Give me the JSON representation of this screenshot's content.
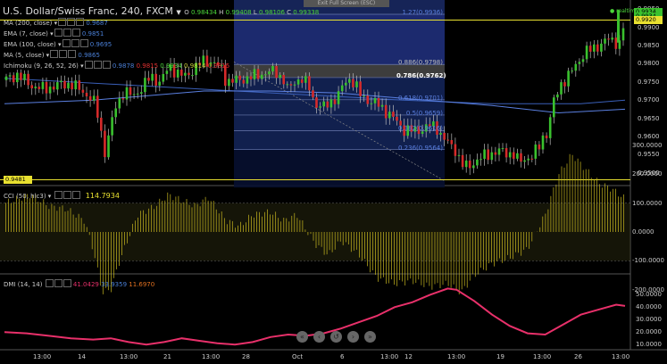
{
  "header": {
    "symbol": "U.S. Dollar/Swiss Franc, 240, FXCM",
    "ohlc": [
      {
        "k": "O",
        "v": "0.98434"
      },
      {
        "k": "H",
        "v": "0.99408"
      },
      {
        "k": "L",
        "v": "0.98106"
      },
      {
        "k": "C",
        "v": "0.99338"
      }
    ],
    "exit_fullscreen": "Exit Full Screen (ESC)",
    "realtime": "realtime"
  },
  "indicators": [
    {
      "label": "MA (200, close)",
      "values": [
        {
          "v": "0.9687",
          "color": "#4a7fd6"
        }
      ]
    },
    {
      "label": "EMA (7, close)",
      "values": [
        {
          "v": "0.9851",
          "color": "#4a7fd6"
        }
      ]
    },
    {
      "label": "EMA (100, close)",
      "values": [
        {
          "v": "0.9695",
          "color": "#4a7fd6"
        }
      ]
    },
    {
      "label": "MA (5, close)",
      "values": [
        {
          "v": "0.9865",
          "color": "#4a7fd6"
        }
      ]
    },
    {
      "label": "Ichimoku (9, 26, 52, 26)",
      "values": [
        {
          "v": "0.9878",
          "color": "#4a7fd6"
        },
        {
          "v": "0.9815",
          "color": "#e03030"
        },
        {
          "v": "0.9934",
          "color": "#4cd63a"
        },
        {
          "v": "0.9814",
          "color": "#cbd23a"
        },
        {
          "v": "0.9815",
          "color": "#e03030"
        }
      ]
    }
  ],
  "fib_levels": [
    {
      "label": "1.27(0.9936)",
      "value": 0.9936
    },
    {
      "label": "0.886(0.9798)",
      "value": 0.9798
    },
    {
      "label": "0.786(0.9762)",
      "value": 0.9762
    },
    {
      "label": "0.618(0.9701)",
      "value": 0.9701
    },
    {
      "label": "0.5(0.9659)",
      "value": 0.9659
    },
    {
      "label": "0.382(0.9616)",
      "value": 0.9616
    },
    {
      "label": "0.236(0.9564)",
      "value": 0.9564
    }
  ],
  "price_axis": {
    "ticks": [
      "0.9950",
      "0.9900",
      "0.9850",
      "0.9800",
      "0.9750",
      "0.9700",
      "0.9650",
      "0.9600",
      "0.9550",
      "0.9500"
    ],
    "current_price_labels": [
      "0.9934",
      "0.9934"
    ],
    "level_labels": [
      "0.9920",
      "0.9481"
    ]
  },
  "cci_panel": {
    "label": "CCI (50, hlc3)",
    "value": "114.7934",
    "ticks": [
      "300.0000",
      "200.0000",
      "100.0000",
      "0.0000",
      "-100.0000",
      "-200.0000"
    ]
  },
  "dmi_panel": {
    "label": "DMI (14, 14)",
    "values": [
      {
        "v": "41.0429",
        "color": "#e8306a"
      },
      {
        "v": "33.9359",
        "color": "#4a7fd6"
      },
      {
        "v": "11.6970",
        "color": "#e07020"
      }
    ],
    "ticks": [
      "50.0000",
      "40.0000",
      "30.0000",
      "20.0000",
      "10.0000"
    ]
  },
  "time_axis": [
    "13:00",
    "14",
    "13:00",
    "21",
    "13:00",
    "28",
    "Oct",
    "6",
    "13:00",
    "12",
    "13:00",
    "19",
    "13:00",
    "26",
    "13:00"
  ],
  "nav_buttons": [
    "rewind-icon",
    "back-icon",
    "reset-icon",
    "forward-icon",
    "end-icon"
  ],
  "chart_data": {
    "type": "candlestick",
    "symbol": "USDCHF",
    "timeframe": "240",
    "price_range": [
      0.9475,
      0.9958
    ],
    "price_path": [
      [
        0,
        0.9755
      ],
      [
        0.03,
        0.977
      ],
      [
        0.06,
        0.974
      ],
      [
        0.09,
        0.973
      ],
      [
        0.12,
        0.9742
      ],
      [
        0.15,
        0.9745
      ],
      [
        0.175,
        0.9725
      ],
      [
        0.2,
        0.97
      ],
      [
        0.215,
        0.964
      ],
      [
        0.225,
        0.955
      ],
      [
        0.235,
        0.96
      ],
      [
        0.25,
        0.968
      ],
      [
        0.27,
        0.9725
      ],
      [
        0.29,
        0.971
      ],
      [
        0.31,
        0.9735
      ],
      [
        0.33,
        0.9765
      ],
      [
        0.35,
        0.975
      ],
      [
        0.365,
        0.9775
      ],
      [
        0.37,
        0.9795
      ],
      [
        0.38,
        0.9785
      ],
      [
        0.395,
        0.977
      ],
      [
        0.41,
        0.9765
      ],
      [
        0.43,
        0.979
      ],
      [
        0.45,
        0.9808
      ],
      [
        0.47,
        0.9805
      ],
      [
        0.49,
        0.9785
      ],
      [
        0.5,
        0.9752
      ],
      [
        0.53,
        0.9755
      ],
      [
        0.56,
        0.9765
      ],
      [
        0.59,
        0.9775
      ],
      [
        0.61,
        0.978
      ],
      [
        0.63,
        0.9755
      ],
      [
        0.64,
        0.9725
      ],
      [
        0.655,
        0.9752
      ],
      [
        0.67,
        0.976
      ],
      [
        0.69,
        0.973
      ],
      [
        0.7,
        0.969
      ],
      [
        0.72,
        0.968
      ],
      [
        0.74,
        0.97
      ],
      [
        0.755,
        0.9715
      ],
      [
        0.765,
        0.9745
      ],
      [
        0.78,
        0.976
      ],
      [
        0.79,
        0.9745
      ],
      [
        0.805,
        0.971
      ],
      [
        0.82,
        0.97
      ],
      [
        0.84,
        0.969
      ],
      [
        0.87,
        0.966
      ],
      [
        0.9,
        0.962
      ],
      [
        0.93,
        0.9615
      ],
      [
        0.96,
        0.963
      ],
      [
        0.975,
        0.9625
      ],
      [
        0.99,
        0.9595
      ],
      [
        1.02,
        0.956
      ],
      [
        1.03,
        0.9525
      ],
      [
        1.045,
        0.9515
      ],
      [
        1.06,
        0.953
      ],
      [
        1.08,
        0.9545
      ],
      [
        1.1,
        0.9555
      ],
      [
        1.12,
        0.956
      ],
      [
        1.135,
        0.9555
      ],
      [
        1.15,
        0.955
      ],
      [
        1.16,
        0.953
      ],
      [
        1.175,
        0.954
      ],
      [
        1.19,
        0.9545
      ],
      [
        1.205,
        0.957
      ],
      [
        1.215,
        0.96
      ],
      [
        1.225,
        0.961
      ],
      [
        1.24,
        0.97
      ],
      [
        1.255,
        0.9745
      ],
      [
        1.27,
        0.976
      ],
      [
        1.29,
        0.98
      ],
      [
        1.31,
        0.983
      ],
      [
        1.33,
        0.9845
      ],
      [
        1.35,
        0.9855
      ],
      [
        1.365,
        0.987
      ],
      [
        1.38,
        0.986
      ],
      [
        1.39,
        0.985
      ],
      [
        1.4,
        0.9932
      ]
    ],
    "ma200": [
      [
        0,
        0.976
      ],
      [
        0.3,
        0.974
      ],
      [
        0.6,
        0.972
      ],
      [
        0.9,
        0.97
      ],
      [
        1.1,
        0.969
      ],
      [
        1.3,
        0.969
      ],
      [
        1.4,
        0.97
      ]
    ],
    "ema100": [
      [
        0,
        0.969
      ],
      [
        0.2,
        0.97
      ],
      [
        0.3,
        0.971
      ],
      [
        0.45,
        0.9725
      ],
      [
        0.6,
        0.9725
      ],
      [
        0.75,
        0.972
      ],
      [
        0.9,
        0.9705
      ],
      [
        1.1,
        0.9685
      ],
      [
        1.25,
        0.9665
      ],
      [
        1.4,
        0.9675
      ]
    ],
    "cci_range": [
      -300,
      300
    ],
    "cci": [
      [
        0,
        100
      ],
      [
        0.06,
        130
      ],
      [
        0.1,
        90
      ],
      [
        0.14,
        80
      ],
      [
        0.18,
        40
      ],
      [
        0.2,
        -60
      ],
      [
        0.22,
        -210
      ],
      [
        0.24,
        -200
      ],
      [
        0.26,
        -100
      ],
      [
        0.3,
        60
      ],
      [
        0.34,
        90
      ],
      [
        0.37,
        130
      ],
      [
        0.4,
        110
      ],
      [
        0.43,
        90
      ],
      [
        0.46,
        120
      ],
      [
        0.5,
        40
      ],
      [
        0.53,
        20
      ],
      [
        0.56,
        60
      ],
      [
        0.6,
        70
      ],
      [
        0.63,
        40
      ],
      [
        0.66,
        60
      ],
      [
        0.7,
        -40
      ],
      [
        0.73,
        -80
      ],
      [
        0.76,
        -30
      ],
      [
        0.8,
        -80
      ],
      [
        0.84,
        -160
      ],
      [
        0.88,
        -180
      ],
      [
        0.92,
        -170
      ],
      [
        0.96,
        -190
      ],
      [
        1.0,
        -180
      ],
      [
        1.03,
        -210
      ],
      [
        1.06,
        -150
      ],
      [
        1.1,
        -110
      ],
      [
        1.14,
        -90
      ],
      [
        1.18,
        -60
      ],
      [
        1.22,
        60
      ],
      [
        1.25,
        200
      ],
      [
        1.28,
        270
      ],
      [
        1.31,
        220
      ],
      [
        1.34,
        170
      ],
      [
        1.37,
        150
      ],
      [
        1.4,
        115
      ]
    ],
    "dmi_range": [
      8,
      56
    ],
    "dmi_adx": [
      [
        0,
        20
      ],
      [
        0.05,
        19
      ],
      [
        0.1,
        17
      ],
      [
        0.15,
        15
      ],
      [
        0.2,
        14
      ],
      [
        0.24,
        15
      ],
      [
        0.28,
        12
      ],
      [
        0.32,
        10
      ],
      [
        0.36,
        12
      ],
      [
        0.4,
        15
      ],
      [
        0.44,
        13
      ],
      [
        0.48,
        11
      ],
      [
        0.52,
        10
      ],
      [
        0.56,
        12
      ],
      [
        0.6,
        16
      ],
      [
        0.64,
        18
      ],
      [
        0.68,
        17
      ],
      [
        0.72,
        19
      ],
      [
        0.76,
        23
      ],
      [
        0.8,
        28
      ],
      [
        0.84,
        33
      ],
      [
        0.88,
        40
      ],
      [
        0.92,
        44
      ],
      [
        0.96,
        50
      ],
      [
        1.0,
        55
      ],
      [
        1.02,
        54
      ],
      [
        1.06,
        45
      ],
      [
        1.1,
        34
      ],
      [
        1.14,
        25
      ],
      [
        1.18,
        19
      ],
      [
        1.22,
        18
      ],
      [
        1.26,
        26
      ],
      [
        1.3,
        34
      ],
      [
        1.34,
        38
      ],
      [
        1.38,
        42
      ],
      [
        1.4,
        41
      ]
    ]
  }
}
